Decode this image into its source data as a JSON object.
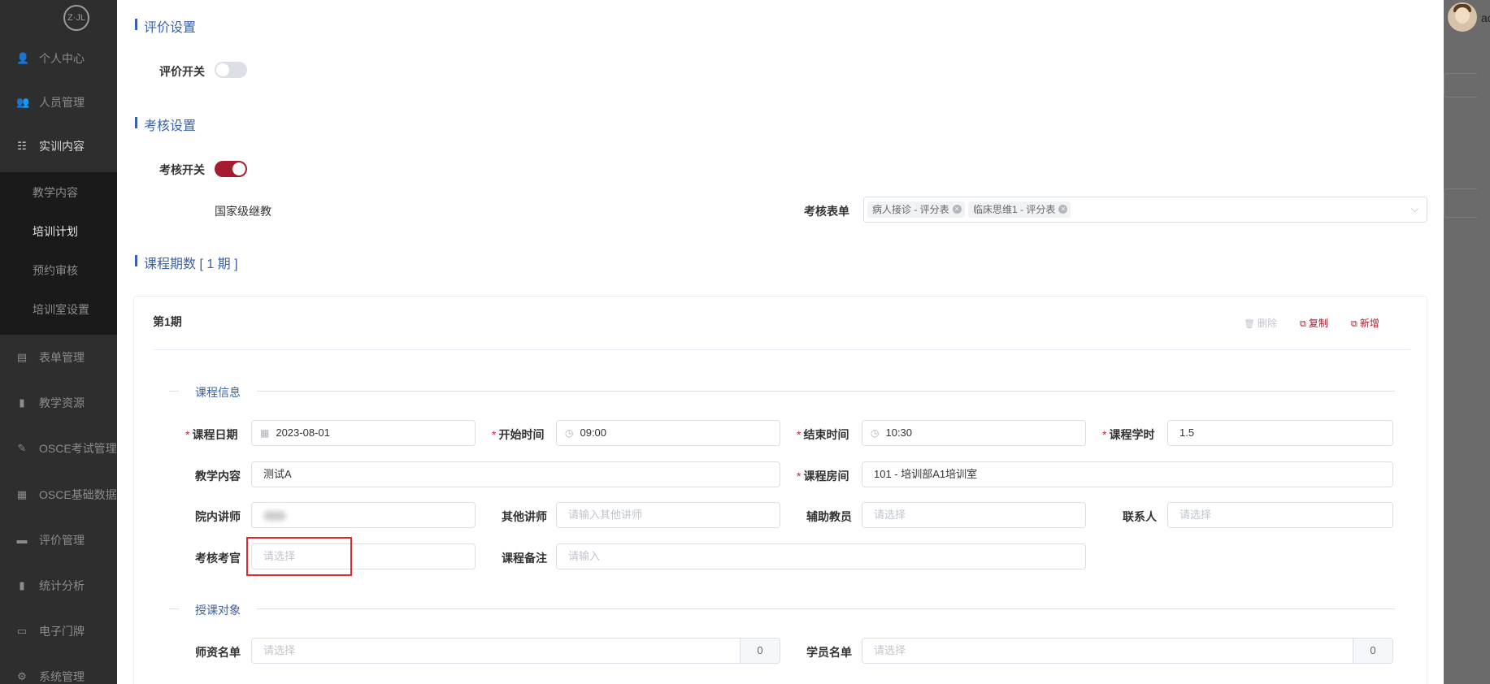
{
  "sidebar": {
    "logo": "Z·JL",
    "items": [
      {
        "label": "个人中心",
        "icon": "👤"
      },
      {
        "label": "人员管理",
        "icon": "👥"
      },
      {
        "label": "实训内容",
        "icon": "☷"
      },
      {
        "label": "表单管理",
        "icon": "▤"
      },
      {
        "label": "教学资源",
        "icon": "▮"
      },
      {
        "label": "OSCE考试管理",
        "icon": "✎"
      },
      {
        "label": "OSCE基础数据",
        "icon": "▦"
      },
      {
        "label": "评价管理",
        "icon": "▬"
      },
      {
        "label": "统计分析",
        "icon": "▮"
      },
      {
        "label": "电子门牌",
        "icon": "▭"
      },
      {
        "label": "系统管理",
        "icon": "⚙"
      }
    ],
    "submenu": [
      "教学内容",
      "培训计划",
      "预约审核",
      "培训室设置"
    ]
  },
  "header_right": {
    "user_text": "ac"
  },
  "evaluation": {
    "section_title": "评价设置",
    "switch_label": "评价开关",
    "switch_on": false
  },
  "assessment": {
    "section_title": "考核设置",
    "switch_label": "考核开关",
    "switch_on": true,
    "level_text": "国家级继教",
    "form_label": "考核表单",
    "form_tags": [
      "病人接诊 - 评分表",
      "临床思维1 - 评分表"
    ]
  },
  "periods": {
    "section_title": "课程期数 [ 1 期 ]",
    "period_title": "第1期",
    "actions": {
      "delete": "删除",
      "copy": "复制",
      "add": "新增"
    },
    "course_info": {
      "divider": "课程信息",
      "date_label": "课程日期",
      "date_value": "2023-08-01",
      "start_label": "开始时间",
      "start_value": "09:00",
      "end_label": "结束时间",
      "end_value": "10:30",
      "hours_label": "课程学时",
      "hours_value": "1.5",
      "content_label": "教学内容",
      "content_value": "测试A",
      "room_label": "课程房间",
      "room_value": "101 - 培训部A1培训室",
      "lecturer_label": "院内讲师",
      "other_lecturer_label": "其他讲师",
      "other_lecturer_placeholder": "请输入其他讲师",
      "assistant_label": "辅助教员",
      "assistant_placeholder": "请选择",
      "contact_label": "联系人",
      "contact_placeholder": "请选择",
      "examiner_label": "考核考官",
      "examiner_placeholder": "请选择",
      "remark_label": "课程备注",
      "remark_placeholder": "请输入"
    },
    "audience": {
      "divider": "授课对象",
      "teacher_label": "师资名单",
      "teacher_placeholder": "请选择",
      "teacher_count": "0",
      "student_label": "学员名单",
      "student_placeholder": "请选择",
      "student_count": "0"
    }
  }
}
